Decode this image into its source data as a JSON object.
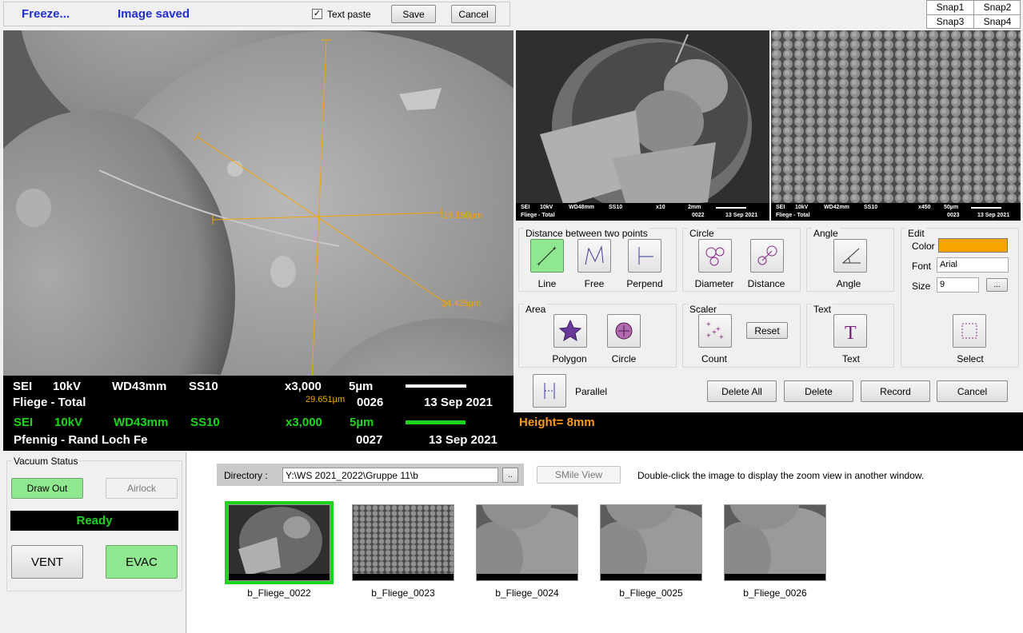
{
  "topbar": {
    "freeze_label": "Freeze...",
    "status_text": "Image saved",
    "text_paste_label": "Text paste",
    "text_paste_checked": true,
    "save_label": "Save",
    "cancel_label": "Cancel"
  },
  "snaps": [
    "Snap1",
    "Snap2",
    "Snap3",
    "Snap4"
  ],
  "main_image": {
    "measurements": [
      "19.150µm",
      "24.425µm",
      "29.651µm"
    ],
    "bar": {
      "mode": "SEI",
      "kv": "10kV",
      "wd": "WD43mm",
      "ss": "SS10",
      "mag": "x3,000",
      "scale": "5µm",
      "title": "Fliege - Total",
      "number": "0026",
      "date": "13 Sep 2021"
    }
  },
  "snapshots": [
    {
      "mode": "SEI",
      "kv": "10kV",
      "wd": "WD48mm",
      "ss": "SS10",
      "mag": "x10",
      "scale": "2mm",
      "title": "Fliege - Total",
      "number": "0022",
      "date": "13 Sep 2021"
    },
    {
      "mode": "SEI",
      "kv": "10kV",
      "wd": "WD42mm",
      "ss": "SS10",
      "mag": "x450",
      "scale": "50µm",
      "title": "Fliege - Total",
      "number": "0023",
      "date": "13 Sep 2021"
    }
  ],
  "tools": {
    "distance_title": "Distance between two points",
    "line_label": "Line",
    "free_label": "Free",
    "perpend_label": "Perpend",
    "circle_title": "Circle",
    "diameter_label": "Diameter",
    "distance_label": "Distance",
    "angle_title": "Angle",
    "angle_label": "Angle",
    "edit_title": "Edit",
    "color_label": "Color",
    "color_value": "#f5a400",
    "font_label": "Font",
    "font_value": "Arial",
    "size_label": "Size",
    "size_value": "9",
    "browse_label": "...",
    "area_title": "Area",
    "polygon_label": "Polygon",
    "area_circle_label": "Circle",
    "scaler_title": "Scaler",
    "count_label": "Count",
    "reset_label": "Reset",
    "text_title": "Text",
    "text_label": "Text",
    "select_label": "Select",
    "parallel_label": "Parallel",
    "delete_all_label": "Delete All",
    "delete_label": "Delete",
    "record_label": "Record",
    "cancel_label": "Cancel"
  },
  "live_bar": {
    "mode": "SEI",
    "kv": "10kV",
    "wd": "WD43mm",
    "ss": "SS10",
    "mag": "x3,000",
    "scale": "5µm",
    "height": "Height= 8mm",
    "title": "Pfennig - Rand Loch Fe",
    "number": "0027",
    "date": "13 Sep 2021"
  },
  "vacuum": {
    "title": "Vacuum Status",
    "draw_out_label": "Draw Out",
    "airlock_label": "Airlock",
    "status": "Ready",
    "vent_label": "VENT",
    "evac_label": "EVAC"
  },
  "browser": {
    "directory_label": "Directory :",
    "directory_value": "Y:\\WS 2021_2022\\Gruppe 11\\b",
    "browse_label": "..",
    "smile_view_label": "SMile View",
    "hint": "Double-click the image to display the zoom view in another window.",
    "thumbnails": [
      "b_Fliege_0022",
      "b_Fliege_0023",
      "b_Fliege_0024",
      "b_Fliege_0025",
      "b_Fliege_0026"
    ]
  },
  "colors": {
    "accent_green": "#1bd41b",
    "measure_orange": "#f5a400",
    "status_blue": "#1f2fd0",
    "height_orange": "#ff9a1a"
  }
}
